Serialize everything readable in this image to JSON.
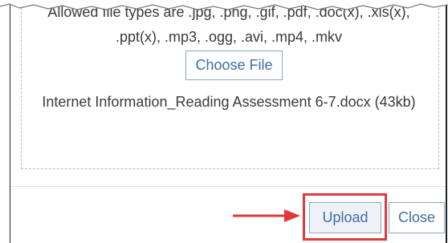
{
  "upload_panel": {
    "allowed_types_line1": "Allowed file types are .jpg, .png, .gif, .pdf, .doc(x), .xls(x),",
    "allowed_types_line2": ".ppt(x), .mp3, .ogg, .avi, .mp4, .mkv",
    "choose_file_label": "Choose File",
    "selected_file": "Internet Information_Reading Assessment 6-7.docx (43kb)"
  },
  "footer": {
    "upload_label": "Upload",
    "close_label": "Close"
  },
  "annotation": {
    "highlight_color": "#e03a3a"
  }
}
